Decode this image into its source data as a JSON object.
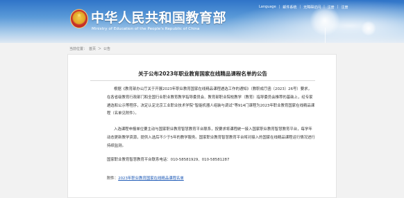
{
  "header": {
    "site_title": "中华人民共和国教育部",
    "site_subtitle": "Ministry of Education of the People's Republic of China",
    "emblem_icon": "national-emblem-icon",
    "nav": [
      {
        "label": "Language"
      },
      {
        "label": "邮件系统"
      },
      {
        "label": "无障碍访问"
      },
      {
        "label": "注册"
      },
      {
        "label": "注册"
      }
    ]
  },
  "breadcrumb": {
    "items": [
      "当前位置：",
      "首页",
      "＞",
      "公告"
    ]
  },
  "article": {
    "title": "关于公布2023年职业教育国家在线精品课程名单的公告",
    "paragraphs": [
      "根据《教育部办公厅关于开展2023年职业教育国家在线精品课程遴选工作的通知》（教职成厅函〔2023〕26号）要求，在各省级教育行政部门和全国行业职业教育教学指导委员会、教育部职业院校教学（教育）指导委员会推荐的基础上，经专家遴选和公示等程序，决定认定北京工业职业技术学院“智能机器人组装与调试”等914门课程为2023年职业教育国家在线精品课程（名单见附件）。",
      "入选课程申报单位要主动与国家职业教育智慧教育平台联系，按要求将课程统一接入国家职业教育智慧教育平台，每学年动态更新教学资源，提供入选后不少于5年的教学服务。国家职业教育智慧教育平台将对接入的国家在线精品课程运行情况进行持续监测。",
      "国家职业教育智慧教育平台联系电话：010-58581929、010-58581287"
    ],
    "attachment_label": "附件：",
    "attachment_link": "2023年职业教育国家在线精品课程名单"
  },
  "colors": {
    "header_blue": "#2f74c8",
    "link_blue": "#1a57b5",
    "page_bg": "#f2f2f2"
  }
}
